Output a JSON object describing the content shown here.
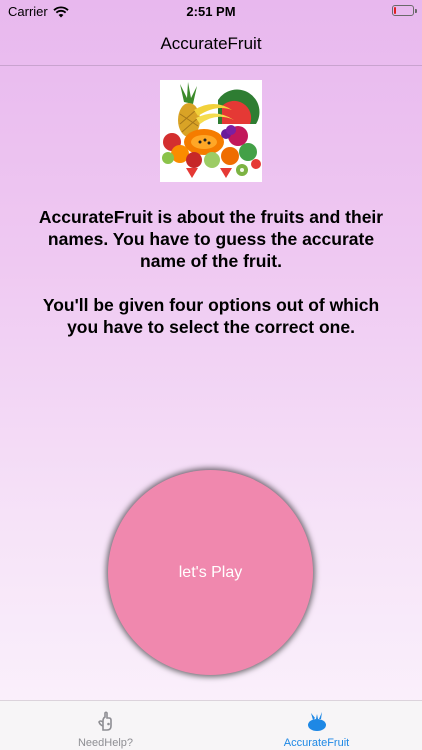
{
  "status_bar": {
    "carrier": "Carrier",
    "time": "2:51 PM",
    "battery_level": 0.12,
    "battery_color": "#e02020"
  },
  "nav": {
    "title": "AccurateFruit"
  },
  "hero": {
    "image_icon": "fruit-assortment-image"
  },
  "description": {
    "paragraph1": "AccurateFruit is about the fruits and their names. You have to guess the accurate name of the fruit.",
    "paragraph2": "You'll be given four options out of which you have to select the correct one."
  },
  "play_button": {
    "label": "let's Play",
    "color": "#f088ae"
  },
  "tab_bar": {
    "tabs": [
      {
        "label": "NeedHelp?",
        "icon": "help-hand-icon",
        "active": false
      },
      {
        "label": "AccurateFruit",
        "icon": "fruit-icon",
        "active": true
      }
    ],
    "active_color": "#1e88e5",
    "inactive_color": "#8e8e93"
  }
}
